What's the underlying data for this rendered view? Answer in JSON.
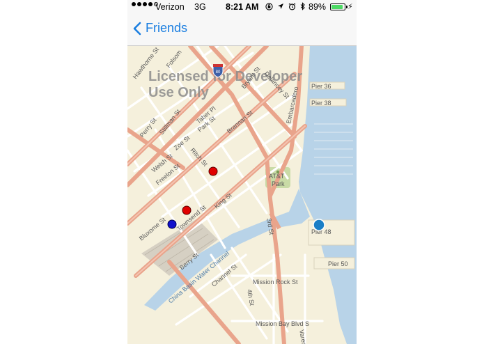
{
  "status_bar": {
    "signal_bars_filled": 4,
    "signal_bars_total": 5,
    "carrier": "Verizon",
    "network": "3G",
    "time": "8:21 AM",
    "status_icons": [
      "orientation-lock-icon",
      "location-arrow-icon",
      "alarm-icon",
      "bluetooth-icon"
    ],
    "battery_percent_label": "89%",
    "battery_level": 0.89,
    "battery_color": "#4cd964"
  },
  "nav_bar": {
    "back_label": "Friends",
    "tint_color": "#1a7ee0"
  },
  "map": {
    "watermark": [
      "Licensed for Developer",
      "Use Only"
    ],
    "street_labels": [
      "Hawthorne St",
      "Folsom",
      "Perry St",
      "Stillman St",
      "Taber Pl",
      "Park St",
      "Brannan St",
      "Bryant St",
      "Delancey St",
      "Welsh St",
      "Zoe St",
      "Freelon St",
      "Ritch St",
      "Townsend St",
      "Bluxome St",
      "King St",
      "Berry St",
      "Channel St",
      "3rd St",
      "4th St",
      "Mission Rock St",
      "Mission Bay Blvd S",
      "Embarcadero",
      "Varennes"
    ],
    "park_label": [
      "AT&T",
      "Park"
    ],
    "water_labels": [
      "China Basin Water Channel"
    ],
    "pier_labels": [
      "Pier 36",
      "Pier 38",
      "Pier 48",
      "Pier 50"
    ],
    "highway_shield": "80",
    "markers": [
      {
        "kind": "friend",
        "color": "#e00000"
      },
      {
        "kind": "friend",
        "color": "#e00000"
      },
      {
        "kind": "friend",
        "color": "#1010cc"
      },
      {
        "kind": "current-location",
        "color": "#1a7ec6"
      }
    ],
    "colors": {
      "land": "#f5f0dc",
      "water": "#b8d3e8",
      "major_road": "#e9a48b",
      "minor_road": "#ffffff",
      "rail": "#cdc7bb"
    }
  }
}
